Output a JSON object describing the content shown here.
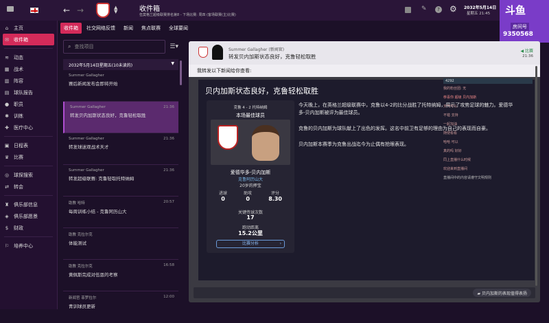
{
  "window": {
    "title": "收件箱",
    "subtitle": "伍莫格兰超级联赛排名第8 - 下场比赛: 周四 (客场联赛(主)比赛)",
    "date": "2032年5月14日",
    "time": "星期五 21:45"
  },
  "stream": {
    "room_label": "房间号",
    "room_number": "9350568"
  },
  "sidebar": {
    "items": [
      {
        "label": "主页"
      },
      {
        "label": "收件箱"
      },
      {
        "label": "动态"
      },
      {
        "label": "战术"
      },
      {
        "label": "阵容"
      },
      {
        "label": "球队报告"
      },
      {
        "label": "职员"
      },
      {
        "label": "训练"
      },
      {
        "label": "医疗中心"
      },
      {
        "label": "日程表"
      },
      {
        "label": "比赛"
      },
      {
        "label": "球探搜索"
      },
      {
        "label": "转会"
      },
      {
        "label": "俱乐部信息"
      },
      {
        "label": "俱乐部愿景"
      },
      {
        "label": "财政"
      },
      {
        "label": "培养中心"
      }
    ]
  },
  "tabs": [
    {
      "label": "收件箱"
    },
    {
      "label": "社交网络反馈"
    },
    {
      "label": "新闻"
    },
    {
      "label": "焦点联赛"
    },
    {
      "label": "全球要闻"
    }
  ],
  "list": {
    "search_placeholder": "查找项目",
    "date_header": "2032年5月14日星期五(10未读的)",
    "items": [
      {
        "sender": "Summer Gallagher",
        "subject": "赛后新闻发布会即将开始",
        "time": ""
      },
      {
        "sender": "Summer Gallagher",
        "subject": "转发贝内加斯状态良好，克鲁轻松取胜",
        "time": "21:36"
      },
      {
        "sender": "Summer Gallagher",
        "subject": "转发球迷观战术天才",
        "time": "21:36"
      },
      {
        "sender": "Summer Gallagher",
        "subject": "转发超级联赛: 克鲁轻取托特纳姆",
        "time": "21:36"
      },
      {
        "sender": "助教 哈特",
        "subject": "每周训练小结 - 克鲁阿历山大",
        "time": "20:57"
      },
      {
        "sender": "助教 克拉尔克",
        "subject": "体能测试",
        "time": ""
      },
      {
        "sender": "助教 克拉尔克",
        "subject": "黄佩斯完成对伍恩的考察",
        "time": "16:58"
      },
      {
        "sender": "新闻官 菲罗拉尔",
        "subject": "青训球员更新",
        "time": "12:00"
      }
    ]
  },
  "message": {
    "sender": "Summer Gallagher (新闻官)",
    "subject": "转发贝内加斯状态良好，克鲁轻松取胜",
    "status": "比赛",
    "time": "21:36",
    "greeting": "我转发以下新闻给你查看:",
    "headline": "贝内加斯状态良好，克鲁轻松取胜",
    "paragraphs": [
      "今天晚上，在英格兰超级联赛中，克鲁以4-2的比分战胜了托特纳姆，展示了攻势足球的魅力。爱德华多-贝内加斯被评为最佳球员。",
      "克鲁的贝内加斯为球队献上了出色的发挥。这名中前卫有足够的理由为自己的表现而自豪。",
      "贝内加斯本赛季为克鲁出战迄今为止偶有抢眼表现。"
    ]
  },
  "player_card": {
    "match": "克鲁 4 - 2 托特纳姆",
    "award": "本场最佳球员",
    "name": "爱德华多-贝内加斯",
    "club": "克鲁阿历山大",
    "age": "20岁的押宝",
    "stats_headers": [
      "进球",
      "助攻",
      "评分"
    ],
    "stats_values": [
      "0",
      "0",
      "8.30"
    ],
    "key_passes_label": "关键传球次数",
    "key_passes": "17",
    "distance_label": "跑动距离",
    "distance": "15.2公里",
    "analysis_button": "比赛分析"
  },
  "chat": {
    "lines": [
      "4292",
      "我的粉丝团: 无",
      "恭喜你 超级 贝内加斯",
      "天气可以",
      "不错 支持",
      "一起加油",
      "随便看看",
      "哈哈 可以",
      "真的吗 好好",
      "同上直播什么时候",
      "欢迎来到直播间"
    ],
    "notice": "直播间中的内容请遵守文明规则",
    "pill": "贝内加斯的表现值得表扬"
  }
}
